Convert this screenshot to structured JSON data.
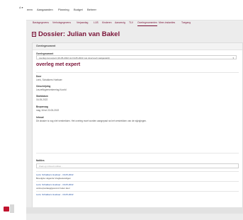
{
  "left": {
    "account_label": "A ▾"
  },
  "topnav": {
    "items": [
      "eren",
      "Aangaanden",
      "Planning",
      "Budget",
      "Beheer"
    ]
  },
  "tabs": [
    "Basisgegevens",
    "Verhuisgegevens",
    "Verjaardag",
    "LIJS",
    "Kinderen",
    "Aanwezig",
    "TLV",
    "Overlegmomenten",
    "Meer-instanties",
    "Toegang"
  ],
  "dossier": {
    "title": "Dossier: Julian van Bakel"
  },
  "card": {
    "header": "Overlegmoment",
    "select_label": "Overlegmoment",
    "select_value": "overleg met expert (16-05-2022 tot 16-05-2022 met Jose'Loeh vastgesteld)",
    "subtitle": "overleg met expert",
    "fields": [
      {
        "label": "Door",
        "value": "Lenk, Schakkers Hoebaer"
      },
      {
        "label": "Omschrijving",
        "value": "Leuzeflogeeverkeering-Koorld"
      },
      {
        "label": "Startdatum",
        "value": "16-05-2022"
      },
      {
        "label": "Bezpensag",
        "value": "mag 16 tot 22-05-2022"
      },
      {
        "label": "Inhoud",
        "value": "Dit dossier is nog niet verstrekken. Het overleg moet worden aangepast na het verstrekken van de wijzigingen."
      }
    ],
    "notes_label": "Notities",
    "search_placeholder": "Zoek op inhoud notities...",
    "notes": [
      {
        "author": "Lenk, Schakkers Hoebaer - 16-05-2022",
        "text": "Bevolgde volgende Vragbestandigen"
      },
      {
        "author": "Lenk, Schakkers Hoebaer - 16-05-2022",
        "text": "verkoopvariaag/gesvond zeker deur"
      },
      {
        "author": "Lenk, Schakkers Hoebaer - 16-05-2022",
        "text": ""
      }
    ]
  },
  "colors": {
    "accent": "#7a1338",
    "danger": "#c0142f",
    "link": "#1f4ea3"
  }
}
